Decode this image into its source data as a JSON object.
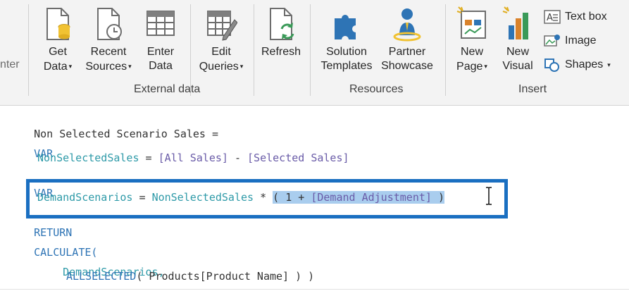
{
  "ribbon": {
    "edge_label": "nter",
    "external_data": {
      "group_label": "External data",
      "buttons": [
        {
          "line1": "Get",
          "line2": "Data"
        },
        {
          "line1": "Recent",
          "line2": "Sources"
        },
        {
          "line1": "Enter",
          "line2": "Data"
        },
        {
          "line1": "Edit",
          "line2": "Queries"
        },
        {
          "line1": "",
          "line2": "Refresh"
        }
      ]
    },
    "resources": {
      "group_label": "Resources",
      "buttons": [
        {
          "line1": "Solution",
          "line2": "Templates"
        },
        {
          "line1": "Partner",
          "line2": "Showcase"
        }
      ]
    },
    "insert": {
      "group_label": "Insert",
      "buttons": [
        {
          "line1": "New",
          "line2": "Page"
        },
        {
          "line1": "New",
          "line2": "Visual"
        }
      ],
      "small_buttons": [
        "Text box",
        "Image",
        "Shapes"
      ]
    },
    "dropdown_caret": "▾"
  },
  "formula": {
    "line1": "Non Selected Scenario Sales =",
    "line2": "VAR",
    "line3": {
      "var": "NonSelectedSales",
      "eq": " = ",
      "m1": "[All Sales]",
      "minus": " - ",
      "m2": "[Selected Sales]"
    },
    "line4": "VAR",
    "line5": {
      "var": "DemandScenarios",
      "eq": " = ",
      "var2": "NonSelectedSales",
      "op": " * ",
      "sel_a": "( 1 + ",
      "sel_m": "[Demand Adjustment]",
      "sel_b": " )"
    },
    "line6": "RETURN",
    "line7": "CALCULATE(",
    "line8": "DemandScenarios,",
    "line9": {
      "fn": "ALLSELECTED",
      "rest": "( Products[Product Name] ) )"
    }
  },
  "colors": {
    "highlight_box": "#1a6fc1",
    "selection": "#a9cdee",
    "keyword": "#2e74b5",
    "variable": "#2e9aa8",
    "measure": "#6a5ca8"
  }
}
